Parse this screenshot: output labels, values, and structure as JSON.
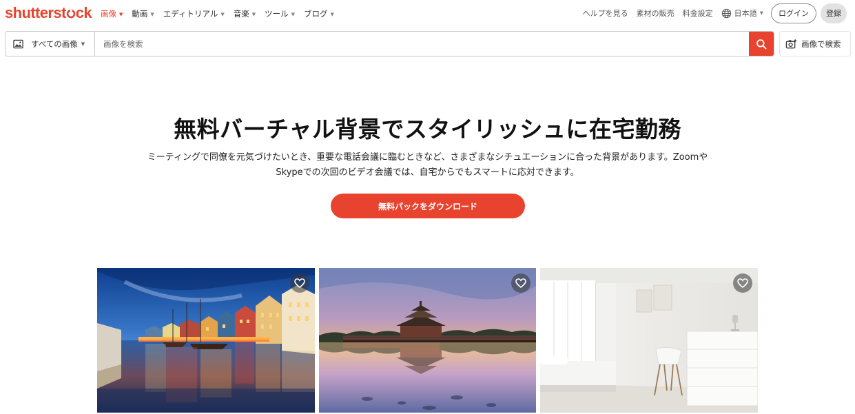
{
  "brand": {
    "logo_text_before": "shutterst",
    "logo_text_after": "ck",
    "accent_color": "#e8432e"
  },
  "nav": {
    "items": [
      {
        "label": "画像",
        "active": true
      },
      {
        "label": "動画",
        "active": false
      },
      {
        "label": "エディトリアル",
        "active": false
      },
      {
        "label": "音楽",
        "active": false
      },
      {
        "label": "ツール",
        "active": false
      },
      {
        "label": "ブログ",
        "active": false
      }
    ],
    "help": "ヘルプを見る",
    "sell": "素材の販売",
    "pricing": "料金設定",
    "language": "日本語",
    "login": "ログイン",
    "signup": "登録"
  },
  "search": {
    "type_label": "すべての画像",
    "placeholder": "画像を検索",
    "value": "",
    "image_search_label": "画像で検索"
  },
  "hero": {
    "title": "無料バーチャル背景でスタイリッシュに在宅勤務",
    "description_line1": "ミーティングで同僚を元気づけたいとき、重要な電話会議に臨むときなど、さまざまなシチュエーションに合った背景があります。Zoomや",
    "description_line2": "Skypeでの次回のビデオ会議では、自宅からでもスマートに応対できます。",
    "button_label": "無料パックをダウンロード"
  },
  "gallery": {
    "images": [
      {
        "subject": "canal-city-night",
        "favorite_icon": "heart-icon"
      },
      {
        "subject": "palace-lake-sunset",
        "favorite_icon": "heart-icon"
      },
      {
        "subject": "white-bedroom-interior",
        "favorite_icon": "heart-icon"
      }
    ]
  }
}
